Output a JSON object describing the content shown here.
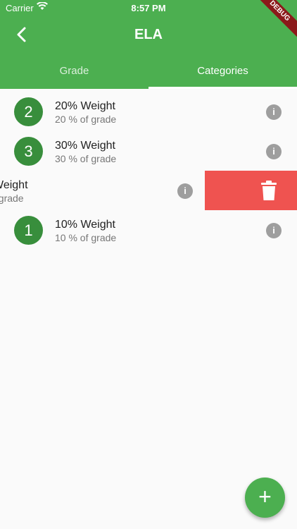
{
  "status_bar": {
    "carrier": "Carrier",
    "time": "8:57 PM"
  },
  "debug_banner": "DEBUG",
  "header": {
    "title": "ELA"
  },
  "tabs": [
    {
      "label": "Grade",
      "selected": false
    },
    {
      "label": "Categories",
      "selected": true
    }
  ],
  "categories": [
    {
      "number": "2",
      "title": "20% Weight",
      "subtitle": "20 % of grade"
    },
    {
      "number": "3",
      "title": "30% Weight",
      "subtitle": "30 % of grade"
    },
    {
      "number": "",
      "title": "Weight",
      "subtitle": "f grade"
    },
    {
      "number": "1",
      "title": "10% Weight",
      "subtitle": "10 % of grade"
    }
  ],
  "icons": {
    "info": "i",
    "fab": "+"
  },
  "colors": {
    "primary": "#4caf50",
    "avatar": "#388e3c",
    "delete": "#ef5350"
  }
}
